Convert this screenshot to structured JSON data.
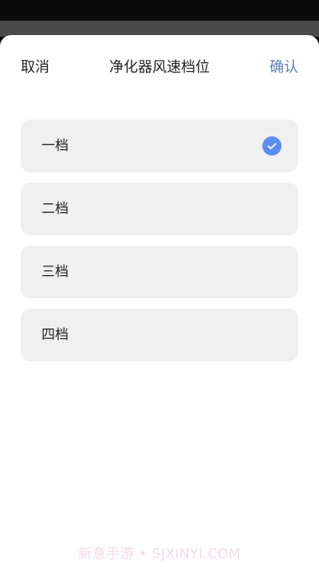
{
  "header": {
    "cancel_label": "取消",
    "title": "净化器风速档位",
    "confirm_label": "确认"
  },
  "options": [
    {
      "label": "一档",
      "selected": true
    },
    {
      "label": "二档",
      "selected": false
    },
    {
      "label": "三档",
      "selected": false
    },
    {
      "label": "四档",
      "selected": false
    }
  ],
  "icons": {
    "selected_check": "check-circle-icon"
  },
  "colors": {
    "accent": "#5b8def",
    "confirm_text": "#5a7fb5",
    "option_bg": "#f0f0f0"
  },
  "watermark": "新意手游 • SJXINYI.COM"
}
